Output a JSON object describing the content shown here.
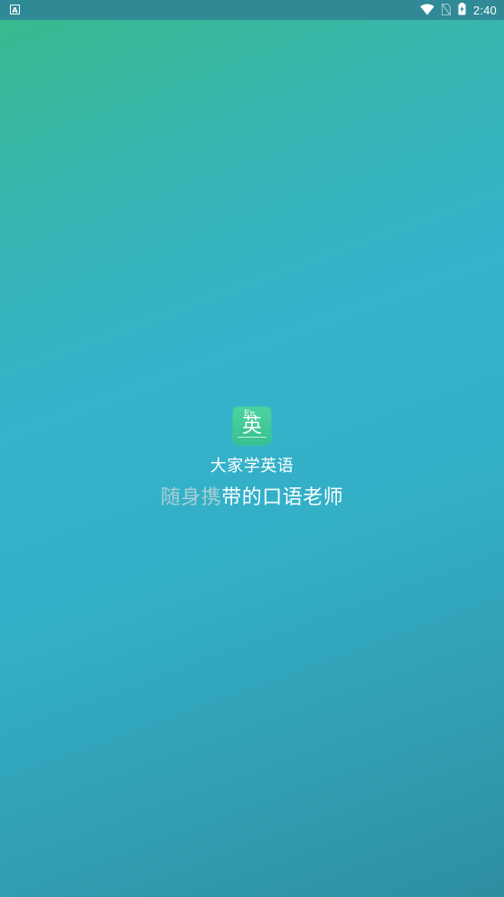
{
  "status_bar": {
    "notification_icon_letter": "A",
    "time": "2:40",
    "icons": [
      "wifi-icon",
      "no-sim-icon",
      "battery-charging-icon"
    ]
  },
  "app_icon": {
    "letters": "En",
    "character": "英"
  },
  "app_name": "大家学英语",
  "slogan": {
    "highlight_part": "随身携",
    "rest_part": "带的口语老师"
  },
  "colors": {
    "status_bar_bg": "#2f8a96",
    "gradient_top": "#3bb88a",
    "gradient_mid": "#33b3cc",
    "gradient_bottom": "#2e8ea0",
    "icon_bg": "#4ed3a0",
    "slogan_dim": "#a9cfd4"
  }
}
